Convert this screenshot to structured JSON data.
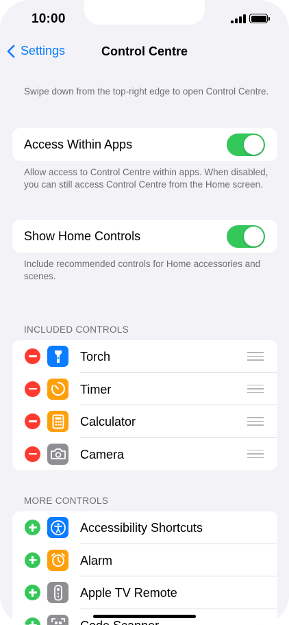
{
  "status_bar": {
    "time": "10:00"
  },
  "nav": {
    "back_label": "Settings",
    "title": "Control Centre"
  },
  "intro_text": "Swipe down from the top-right edge to open Control Centre.",
  "access_within_apps": {
    "label": "Access Within Apps",
    "on": true,
    "footer": "Allow access to Control Centre within apps. When disabled, you can still access Control Centre from the Home screen."
  },
  "show_home_controls": {
    "label": "Show Home Controls",
    "on": true,
    "footer": "Include recommended controls for Home accessories and scenes."
  },
  "included_controls": {
    "header": "INCLUDED CONTROLS",
    "items": [
      {
        "label": "Torch",
        "icon": "torch-icon",
        "color": "#0a7cff"
      },
      {
        "label": "Timer",
        "icon": "timer-icon",
        "color": "#ff9f0a"
      },
      {
        "label": "Calculator",
        "icon": "calculator-icon",
        "color": "#ff9f0a"
      },
      {
        "label": "Camera",
        "icon": "camera-icon",
        "color": "#8e8e93"
      }
    ]
  },
  "more_controls": {
    "header": "MORE CONTROLS",
    "items": [
      {
        "label": "Accessibility Shortcuts",
        "icon": "accessibility-icon",
        "color": "#0a7cff"
      },
      {
        "label": "Alarm",
        "icon": "alarm-icon",
        "color": "#ff9f0a"
      },
      {
        "label": "Apple TV Remote",
        "icon": "remote-icon",
        "color": "#8e8e93"
      },
      {
        "label": "Code Scanner",
        "icon": "qr-icon",
        "color": "#8e8e93"
      }
    ]
  },
  "colors": {
    "accent": "#0a7cff",
    "toggle_on": "#34c759",
    "remove": "#ff3b30",
    "background": "#f2f2f7"
  }
}
